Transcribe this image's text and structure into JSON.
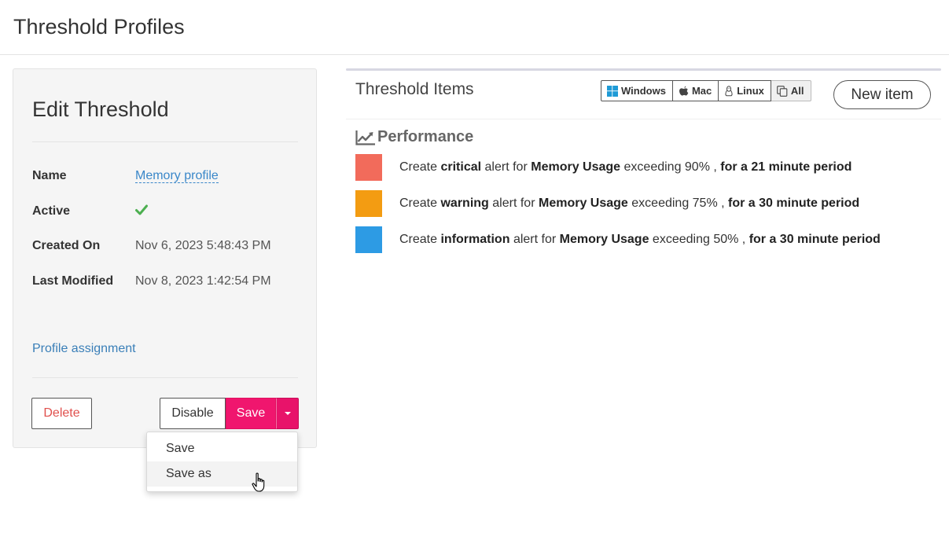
{
  "page": {
    "title": "Threshold Profiles"
  },
  "edit": {
    "title": "Edit Threshold",
    "fields": {
      "name_label": "Name",
      "name_value": "Memory profile",
      "active_label": "Active",
      "created_label": "Created On",
      "created_value": "Nov 6, 2023 5:48:43 PM",
      "modified_label": "Last Modified",
      "modified_value": "Nov 8, 2023 1:42:54 PM"
    },
    "assignment_link": "Profile assignment",
    "buttons": {
      "delete": "Delete",
      "disable": "Disable",
      "save": "Save"
    },
    "dropdown": {
      "items": [
        "Save",
        "Save as"
      ]
    }
  },
  "items": {
    "title": "Threshold Items",
    "os_filters": [
      "Windows",
      "Mac",
      "Linux",
      "All"
    ],
    "new_item": "New item",
    "section": "Performance",
    "rules": [
      {
        "color": "#f26b5b",
        "prefix": "Create",
        "severity": "critical",
        "mid": "alert for",
        "metric": "Memory Usage",
        "exceed": "exceeding 90% ,",
        "period": "for a 21 minute period"
      },
      {
        "color": "#f39c12",
        "prefix": "Create",
        "severity": "warning",
        "mid": "alert for",
        "metric": "Memory Usage",
        "exceed": "exceeding 75% ,",
        "period": "for a 30 minute period"
      },
      {
        "color": "#2d9be4",
        "prefix": "Create",
        "severity": "information",
        "mid": "alert for",
        "metric": "Memory Usage",
        "exceed": "exceeding 50% ,",
        "period": "for a 30 minute period"
      }
    ]
  },
  "colors": {
    "accent": "#f0166e",
    "link": "#3a87c9",
    "success": "#4caf50"
  }
}
